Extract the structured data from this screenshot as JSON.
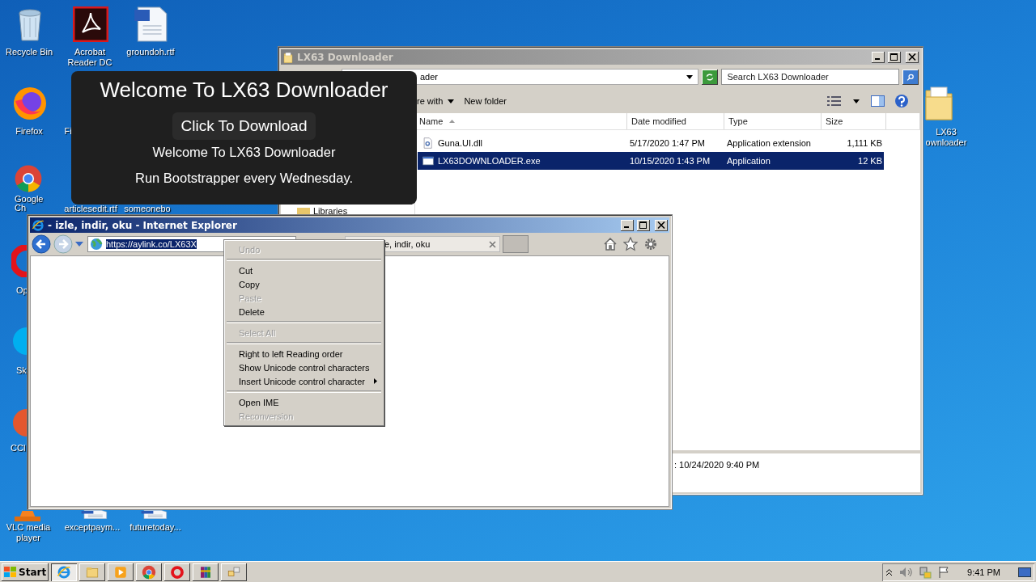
{
  "desktop_icons": [
    {
      "label": "Recycle Bin",
      "kind": "recycle"
    },
    {
      "label": "Acrobat Reader DC",
      "kind": "pdf"
    },
    {
      "label": "groundoh.rtf",
      "kind": "doc"
    },
    {
      "label": "Firefox",
      "kind": "firefox"
    },
    {
      "label": "Fi"
    },
    {
      "label": "Google Ch",
      "kind": "chrome"
    },
    {
      "label": "articlesedit.rtf"
    },
    {
      "label": "someonebo"
    },
    {
      "label": "Op",
      "kind": "opera"
    },
    {
      "label": "Sk",
      "kind": "skype"
    },
    {
      "label": "CCl",
      "kind": "ccleaner"
    },
    {
      "label": "VLC media player",
      "kind": "vlc"
    },
    {
      "label": "exceptpaym...",
      "kind": "doc"
    },
    {
      "label": "futuretoday...",
      "kind": "doc"
    },
    {
      "label": "LX63 ownloader",
      "kind": "folder"
    }
  ],
  "explorer": {
    "title": "LX63 Downloader",
    "address": "ader",
    "search_placeholder": "Search LX63 Downloader",
    "toolbar": [
      "re with",
      "New folder"
    ],
    "columns": [
      "Name",
      "Date modified",
      "Type",
      "Size"
    ],
    "rows": [
      {
        "name": "Guna.UI.dll",
        "date": "5/17/2020 1:47 PM",
        "type": "Application extension",
        "size": "1,111 KB",
        "kind": "dll",
        "selected": false
      },
      {
        "name": "LX63DOWNLOADER.exe",
        "date": "10/15/2020 1:43 PM",
        "type": "Application",
        "size": "12 KB",
        "kind": "exe",
        "selected": true
      }
    ],
    "nav": [
      "Libraries"
    ],
    "details": ": 10/24/2020 9:40 PM"
  },
  "popup": {
    "heading": "Welcome To LX63 Downloader",
    "button": "Click To Download",
    "lines": [
      "Welcome To LX63 Downloader",
      "Run Bootstrapper every Wednesday."
    ]
  },
  "ie": {
    "title": "- izle, indir, oku - Internet Explorer",
    "url": "https://aylink.co/LX63X",
    "url_selected": true,
    "tab": "e, indir, oku"
  },
  "context_menu": {
    "items": [
      {
        "kind": "item",
        "label": "Undo",
        "disabled": true,
        "submenu": false
      },
      {
        "kind": "separator"
      },
      {
        "kind": "item",
        "label": "Cut",
        "disabled": false,
        "submenu": false
      },
      {
        "kind": "item",
        "label": "Copy",
        "disabled": false,
        "submenu": false
      },
      {
        "kind": "item",
        "label": "Paste",
        "disabled": true,
        "submenu": false
      },
      {
        "kind": "item",
        "label": "Delete",
        "disabled": false,
        "submenu": false
      },
      {
        "kind": "separator"
      },
      {
        "kind": "item",
        "label": "Select All",
        "disabled": true,
        "submenu": false
      },
      {
        "kind": "separator"
      },
      {
        "kind": "item",
        "label": "Right to left Reading order",
        "disabled": false,
        "submenu": false
      },
      {
        "kind": "item",
        "label": "Show Unicode control characters",
        "disabled": false,
        "submenu": false
      },
      {
        "kind": "item",
        "label": "Insert Unicode control character",
        "disabled": false,
        "submenu": true
      },
      {
        "kind": "separator"
      },
      {
        "kind": "item",
        "label": "Open IME",
        "disabled": false,
        "submenu": false
      },
      {
        "kind": "item",
        "label": "Reconversion",
        "disabled": true,
        "submenu": false
      }
    ]
  },
  "taskbar": {
    "start": "Start",
    "apps": [
      {
        "kind": "ie",
        "selected": true
      },
      {
        "kind": "explorer",
        "selected": false
      },
      {
        "kind": "media",
        "selected": false
      },
      {
        "kind": "chrome",
        "selected": false
      },
      {
        "kind": "opera",
        "selected": false
      },
      {
        "kind": "winrar",
        "selected": false
      },
      {
        "kind": "network",
        "selected": false
      }
    ],
    "clock": "9:41 PM"
  }
}
